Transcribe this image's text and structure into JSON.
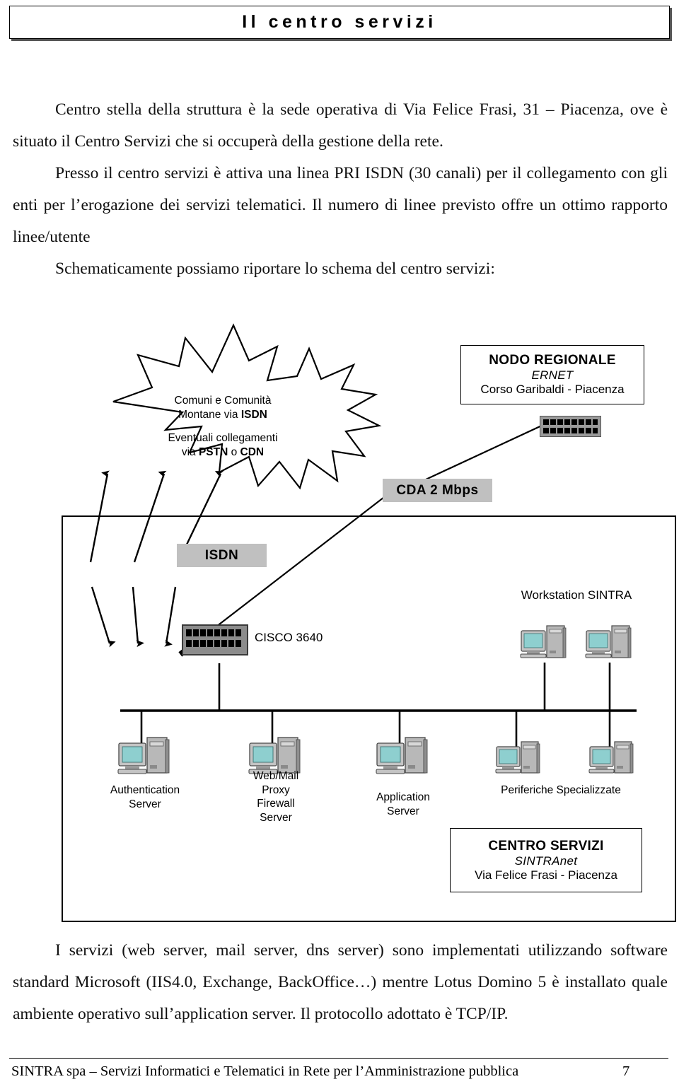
{
  "header": {
    "title": "Il centro servizi"
  },
  "body": {
    "p1": "Centro stella della struttura è la sede operativa di Via Felice Frasi, 31 – Piacenza, ove è situato il Centro Servizi che si occuperà della gestione della rete.",
    "p2": "Presso il centro servizi è attiva una linea PRI ISDN (30 canali) per il collegamento con gli enti per l’erogazione dei servizi telematici. Il numero di linee previsto offre un ottimo rapporto linee/utente",
    "p3": "Schematicamente possiamo riportare lo schema del centro servizi:",
    "p4": "I servizi (web server, mail server, dns server) sono implementati utilizzando software standard Microsoft (IIS4.0, Exchange, BackOffice…) mentre Lotus Domino 5 è installato quale ambiente operativo sull’application server. Il protocollo adottato è TCP/IP."
  },
  "footer": {
    "text": "SINTRA spa – Servizi Informatici e Telematici in Rete per l’Amministrazione pubblica",
    "page": "7"
  },
  "diagram": {
    "burst": {
      "line1": "Comuni e Comunità",
      "line2_prefix": "Montane via ",
      "line2_bold": "ISDN",
      "line3": "Eventuali collegamenti",
      "line4_prefix": "via ",
      "line4_bold1": "PSTN",
      "line4_mid": " o ",
      "line4_bold2": "CDN"
    },
    "regional_node": {
      "line1": "NODO REGIONALE",
      "line2": "ERNET",
      "line3": "Corso Garibaldi - Piacenza"
    },
    "service_center": {
      "line1": "CENTRO SERVIZI",
      "line2": "SINTRAnet",
      "line3": "Via Felice Frasi - Piacenza"
    },
    "cda_label": "CDA 2 Mbps",
    "isdn_label": "ISDN",
    "router_label": "CISCO 3640",
    "workstation_label": "Workstation SINTRA",
    "servers": [
      {
        "label": "Authentication\nServer"
      },
      {
        "label": "Web/Mail\nProxy\nFirewall\nServer"
      },
      {
        "label": "Application\nServer"
      },
      {
        "label": "Periferiche Specializzate"
      }
    ],
    "colors": {
      "chip_gray": "#c0c0c0",
      "screen_teal": "#8ecfcf",
      "case_gray": "#b3b3b3",
      "line_black": "#000000"
    }
  }
}
